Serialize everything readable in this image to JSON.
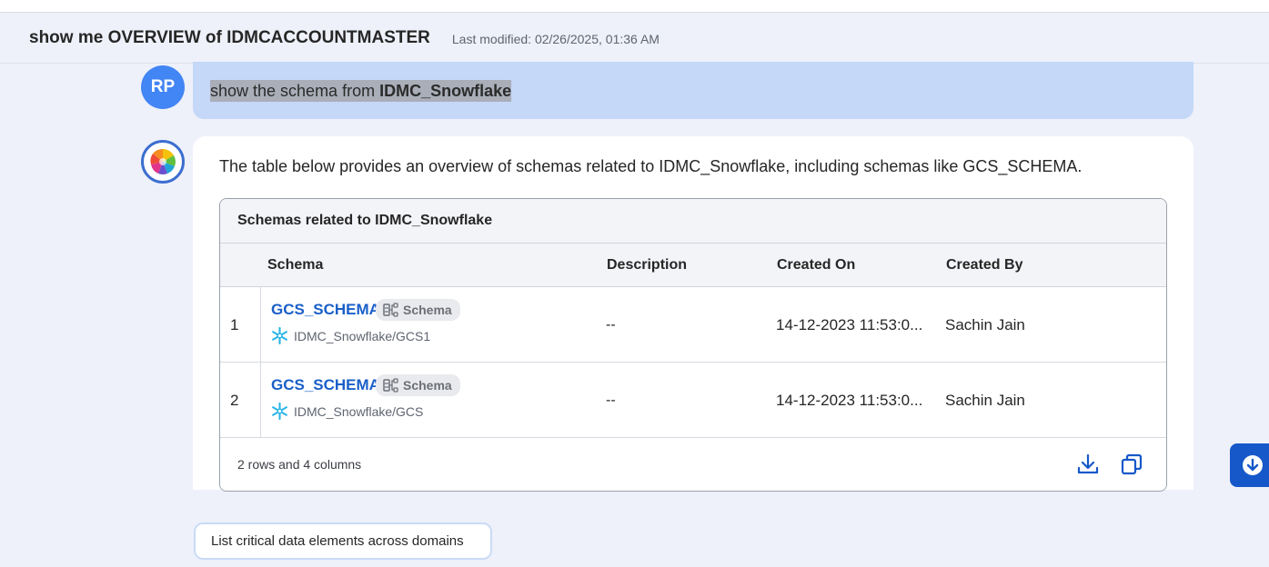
{
  "header": {
    "title": "show me OVERVIEW of IDMCACCOUNTMASTER",
    "last_modified": "Last modified: 02/26/2025, 01:36 AM"
  },
  "user_message": {
    "avatar_initials": "RP",
    "text_prefix": "show the schema from ",
    "text_bold": "IDMC_Snowflake"
  },
  "assistant_message": {
    "text": "The table below provides an overview of schemas related to IDMC_Snowflake, including schemas like GCS_SCHEMA.",
    "table": {
      "title": "Schemas related to IDMC_Snowflake",
      "columns": [
        "Schema",
        "Description",
        "Created On",
        "Created By"
      ],
      "rows": [
        {
          "index": "1",
          "name": "GCS_SCHEMA",
          "badge": "Schema",
          "path": "IDMC_Snowflake/GCS1",
          "description": "--",
          "created_on": "14-12-2023 11:53:0...",
          "created_by": "Sachin Jain"
        },
        {
          "index": "2",
          "name": "GCS_SCHEMA",
          "badge": "Schema",
          "path": "IDMC_Snowflake/GCS",
          "description": "--",
          "created_on": "14-12-2023 11:53:0...",
          "created_by": "Sachin Jain"
        }
      ],
      "summary": "2 rows and 4 columns"
    }
  },
  "suggestion": "List critical data elements across domains",
  "colors": {
    "accent": "#1658c9",
    "link": "#1a5fc8",
    "user_bubble": "#c5d8f8",
    "user_avatar": "#4285f4",
    "snowflake": "#29b5e8"
  },
  "icons": {
    "download": "download-icon",
    "copy": "copy-icon",
    "scroll_down": "arrow-down-circle-icon",
    "schema": "schema-icon",
    "snowflake": "snowflake-icon",
    "bot": "brain-logo-icon"
  }
}
